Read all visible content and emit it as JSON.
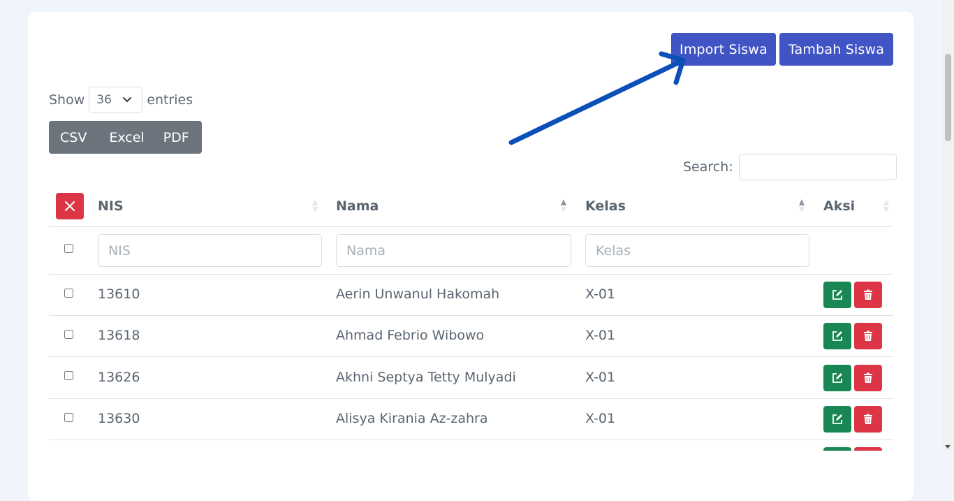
{
  "toolbar": {
    "import_label": "Import Siswa",
    "add_label": "Tambah Siswa"
  },
  "length": {
    "show": "Show",
    "value": "36",
    "entries": "entries"
  },
  "export": {
    "csv": "CSV",
    "excel": "Excel",
    "pdf": "PDF"
  },
  "search": {
    "label": "Search:",
    "value": ""
  },
  "columns": {
    "nis": "NIS",
    "nama": "Nama",
    "kelas": "Kelas",
    "aksi": "Aksi"
  },
  "filters": {
    "nis": "NIS",
    "nama": "Nama",
    "kelas": "Kelas"
  },
  "rows": [
    {
      "nis": "13610",
      "nama": "Aerin Unwanul Hakomah",
      "kelas": "X-01"
    },
    {
      "nis": "13618",
      "nama": "Ahmad Febrio Wibowo",
      "kelas": "X-01"
    },
    {
      "nis": "13626",
      "nama": "Akhni Septya Tetty Mulyadi",
      "kelas": "X-01"
    },
    {
      "nis": "13630",
      "nama": "Alisya Kirania Az-zahra",
      "kelas": "X-01"
    }
  ],
  "colors": {
    "primary": "#4154c4",
    "secondary": "#6c757d",
    "danger": "#dc3545",
    "success": "#198754",
    "annotation_arrow": "#0b4fb8"
  }
}
